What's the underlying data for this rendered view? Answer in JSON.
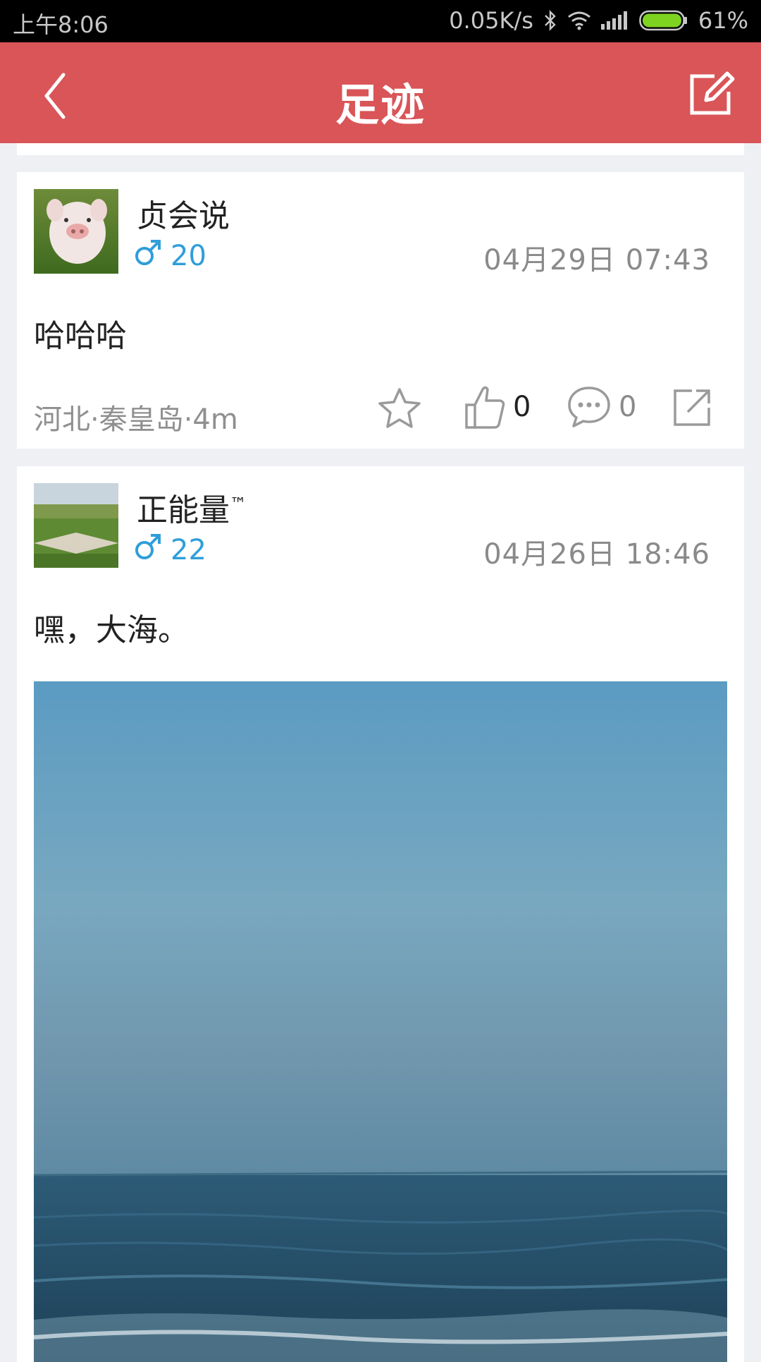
{
  "status_bar": {
    "time": "上午8:06",
    "speed": "0.05K/s",
    "battery_percent": "61%",
    "battery_level": 0.61,
    "icons": [
      "bluetooth-icon",
      "wifi-icon",
      "signal-icon",
      "battery-icon"
    ]
  },
  "header": {
    "title": "足迹",
    "back_icon": "chevron-left-icon",
    "edit_icon": "compose-icon"
  },
  "colors": {
    "header": "#d95558",
    "accent_blue": "#2f9ed9",
    "background": "#eff0f4"
  },
  "posts": [
    {
      "username": "贞会说",
      "gender_symbol": "♂",
      "age": "20",
      "timestamp": "04月29日  07:43",
      "text": "哈哈哈",
      "location": "河北·秦皇岛·4m",
      "likes": "0",
      "comments": "0"
    },
    {
      "username": "正能量",
      "username_mark": "™",
      "gender_symbol": "♂",
      "age": "22",
      "timestamp": "04月26日  18:46",
      "text": "嘿，大海。"
    }
  ]
}
